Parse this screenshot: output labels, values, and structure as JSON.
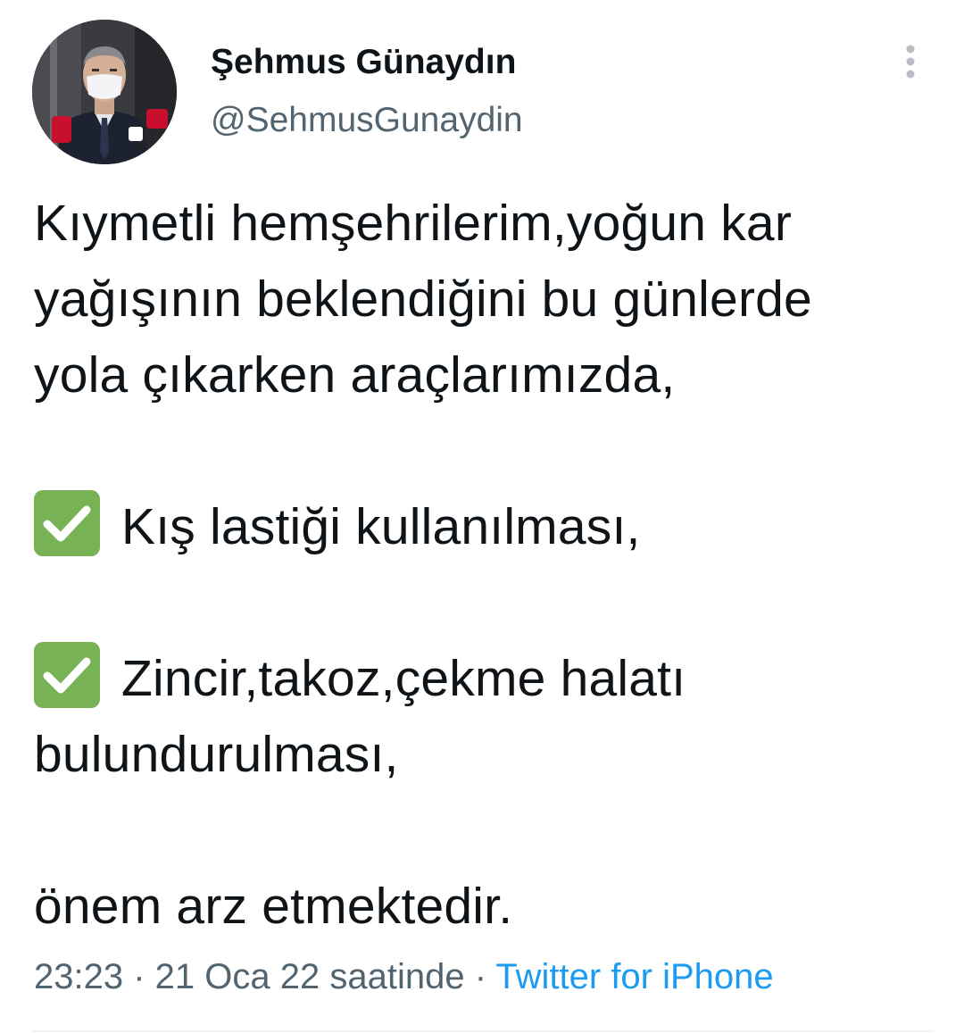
{
  "tweet": {
    "author": {
      "display_name": "Şehmus Günaydın",
      "handle": "@SehmusGunaydin",
      "avatar_icon": "profile-photo"
    },
    "more_icon": "more-vertical-icon",
    "text": {
      "line1": "Kıymetli hemşehrilerim,yoğun kar",
      "line2": "yağışının beklendiğini bu günlerde",
      "line3": "yola çıkarken araçlarımızda,",
      "item1": "Kış lastiği kullanılması,",
      "item2_line1": "Zincir,takoz,çekme halatı",
      "item2_line2": "bulundurulması,",
      "closing": "önem arz etmektedir."
    },
    "check_icon": "check-mark-button-emoji",
    "meta": {
      "time": "23:23",
      "separator1": " · ",
      "date": "21 Oca 22 saatinde",
      "separator2": " · ",
      "source": "Twitter for iPhone"
    }
  },
  "colors": {
    "text_primary": "#0f1419",
    "text_secondary": "#536471",
    "link": "#1d9bf0",
    "check_green": "#77b255"
  }
}
